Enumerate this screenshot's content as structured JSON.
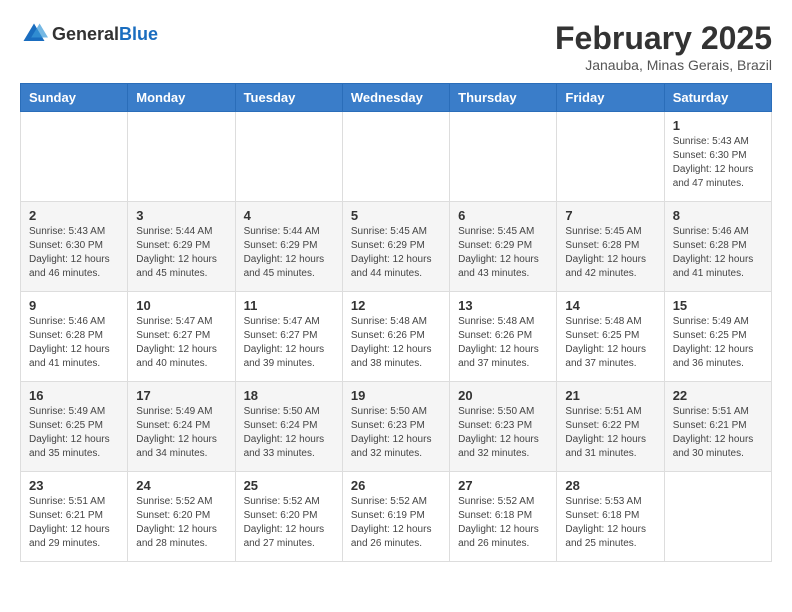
{
  "header": {
    "logo_general": "General",
    "logo_blue": "Blue",
    "title": "February 2025",
    "subtitle": "Janauba, Minas Gerais, Brazil"
  },
  "days_of_week": [
    "Sunday",
    "Monday",
    "Tuesday",
    "Wednesday",
    "Thursday",
    "Friday",
    "Saturday"
  ],
  "weeks": [
    [
      {
        "day": "",
        "info": ""
      },
      {
        "day": "",
        "info": ""
      },
      {
        "day": "",
        "info": ""
      },
      {
        "day": "",
        "info": ""
      },
      {
        "day": "",
        "info": ""
      },
      {
        "day": "",
        "info": ""
      },
      {
        "day": "1",
        "info": "Sunrise: 5:43 AM\nSunset: 6:30 PM\nDaylight: 12 hours\nand 47 minutes."
      }
    ],
    [
      {
        "day": "2",
        "info": "Sunrise: 5:43 AM\nSunset: 6:30 PM\nDaylight: 12 hours\nand 46 minutes."
      },
      {
        "day": "3",
        "info": "Sunrise: 5:44 AM\nSunset: 6:29 PM\nDaylight: 12 hours\nand 45 minutes."
      },
      {
        "day": "4",
        "info": "Sunrise: 5:44 AM\nSunset: 6:29 PM\nDaylight: 12 hours\nand 45 minutes."
      },
      {
        "day": "5",
        "info": "Sunrise: 5:45 AM\nSunset: 6:29 PM\nDaylight: 12 hours\nand 44 minutes."
      },
      {
        "day": "6",
        "info": "Sunrise: 5:45 AM\nSunset: 6:29 PM\nDaylight: 12 hours\nand 43 minutes."
      },
      {
        "day": "7",
        "info": "Sunrise: 5:45 AM\nSunset: 6:28 PM\nDaylight: 12 hours\nand 42 minutes."
      },
      {
        "day": "8",
        "info": "Sunrise: 5:46 AM\nSunset: 6:28 PM\nDaylight: 12 hours\nand 41 minutes."
      }
    ],
    [
      {
        "day": "9",
        "info": "Sunrise: 5:46 AM\nSunset: 6:28 PM\nDaylight: 12 hours\nand 41 minutes."
      },
      {
        "day": "10",
        "info": "Sunrise: 5:47 AM\nSunset: 6:27 PM\nDaylight: 12 hours\nand 40 minutes."
      },
      {
        "day": "11",
        "info": "Sunrise: 5:47 AM\nSunset: 6:27 PM\nDaylight: 12 hours\nand 39 minutes."
      },
      {
        "day": "12",
        "info": "Sunrise: 5:48 AM\nSunset: 6:26 PM\nDaylight: 12 hours\nand 38 minutes."
      },
      {
        "day": "13",
        "info": "Sunrise: 5:48 AM\nSunset: 6:26 PM\nDaylight: 12 hours\nand 37 minutes."
      },
      {
        "day": "14",
        "info": "Sunrise: 5:48 AM\nSunset: 6:25 PM\nDaylight: 12 hours\nand 37 minutes."
      },
      {
        "day": "15",
        "info": "Sunrise: 5:49 AM\nSunset: 6:25 PM\nDaylight: 12 hours\nand 36 minutes."
      }
    ],
    [
      {
        "day": "16",
        "info": "Sunrise: 5:49 AM\nSunset: 6:25 PM\nDaylight: 12 hours\nand 35 minutes."
      },
      {
        "day": "17",
        "info": "Sunrise: 5:49 AM\nSunset: 6:24 PM\nDaylight: 12 hours\nand 34 minutes."
      },
      {
        "day": "18",
        "info": "Sunrise: 5:50 AM\nSunset: 6:24 PM\nDaylight: 12 hours\nand 33 minutes."
      },
      {
        "day": "19",
        "info": "Sunrise: 5:50 AM\nSunset: 6:23 PM\nDaylight: 12 hours\nand 32 minutes."
      },
      {
        "day": "20",
        "info": "Sunrise: 5:50 AM\nSunset: 6:23 PM\nDaylight: 12 hours\nand 32 minutes."
      },
      {
        "day": "21",
        "info": "Sunrise: 5:51 AM\nSunset: 6:22 PM\nDaylight: 12 hours\nand 31 minutes."
      },
      {
        "day": "22",
        "info": "Sunrise: 5:51 AM\nSunset: 6:21 PM\nDaylight: 12 hours\nand 30 minutes."
      }
    ],
    [
      {
        "day": "23",
        "info": "Sunrise: 5:51 AM\nSunset: 6:21 PM\nDaylight: 12 hours\nand 29 minutes."
      },
      {
        "day": "24",
        "info": "Sunrise: 5:52 AM\nSunset: 6:20 PM\nDaylight: 12 hours\nand 28 minutes."
      },
      {
        "day": "25",
        "info": "Sunrise: 5:52 AM\nSunset: 6:20 PM\nDaylight: 12 hours\nand 27 minutes."
      },
      {
        "day": "26",
        "info": "Sunrise: 5:52 AM\nSunset: 6:19 PM\nDaylight: 12 hours\nand 26 minutes."
      },
      {
        "day": "27",
        "info": "Sunrise: 5:52 AM\nSunset: 6:18 PM\nDaylight: 12 hours\nand 26 minutes."
      },
      {
        "day": "28",
        "info": "Sunrise: 5:53 AM\nSunset: 6:18 PM\nDaylight: 12 hours\nand 25 minutes."
      },
      {
        "day": "",
        "info": ""
      }
    ]
  ]
}
